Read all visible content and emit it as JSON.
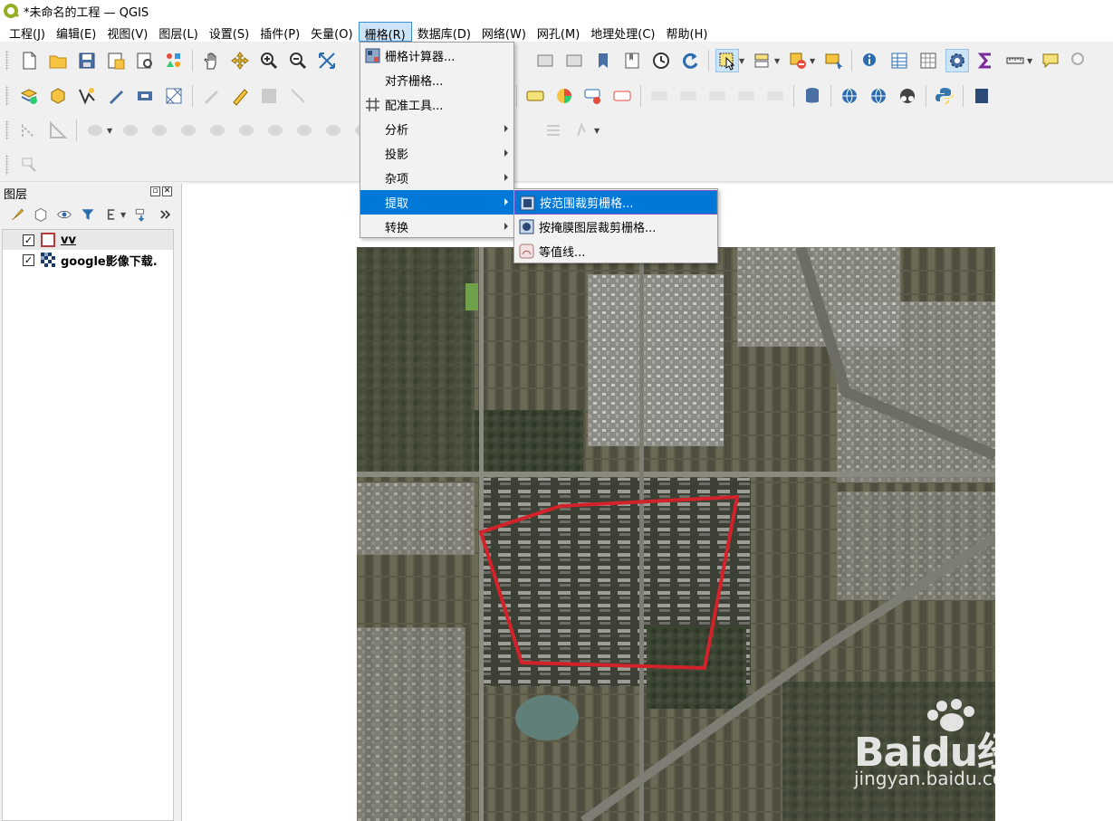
{
  "window": {
    "title": "*未命名的工程 — QGIS"
  },
  "menubar": [
    {
      "label": "工程(J)"
    },
    {
      "label": "编辑(E)"
    },
    {
      "label": "视图(V)"
    },
    {
      "label": "图层(L)"
    },
    {
      "label": "设置(S)"
    },
    {
      "label": "插件(P)"
    },
    {
      "label": "矢量(O)"
    },
    {
      "label": "栅格(R)"
    },
    {
      "label": "数据库(D)"
    },
    {
      "label": "网络(W)"
    },
    {
      "label": "网孔(M)"
    },
    {
      "label": "地理处理(C)"
    },
    {
      "label": "帮助(H)"
    }
  ],
  "raster_menu": {
    "items": [
      {
        "label": "栅格计算器...",
        "icon": "raster-calculator-icon"
      },
      {
        "label": "对齐栅格..."
      },
      {
        "label": "配准工具...",
        "icon": "georeferencer-icon"
      },
      {
        "label": "分析",
        "submenu": true
      },
      {
        "label": "投影",
        "submenu": true
      },
      {
        "label": "杂项",
        "submenu": true
      },
      {
        "label": "提取",
        "submenu": true
      },
      {
        "label": "转换",
        "submenu": true
      }
    ]
  },
  "extraction_submenu": {
    "items": [
      {
        "label": "按范围裁剪栅格..."
      },
      {
        "label": "按掩膜图层裁剪栅格..."
      },
      {
        "label": "等值线..."
      }
    ]
  },
  "layers_panel": {
    "title": "图层",
    "layers": [
      {
        "name": "vv",
        "checked": "✓"
      },
      {
        "name": "google影像下载.",
        "checked": "✓"
      }
    ]
  },
  "map": {
    "polygon_color": "#d2232a"
  },
  "watermark": {
    "brand": "Baidu经验",
    "url": "jingyan.baidu.com"
  },
  "colors": {
    "highlight": "#0078d7",
    "menu_active": "#cce4f7"
  }
}
